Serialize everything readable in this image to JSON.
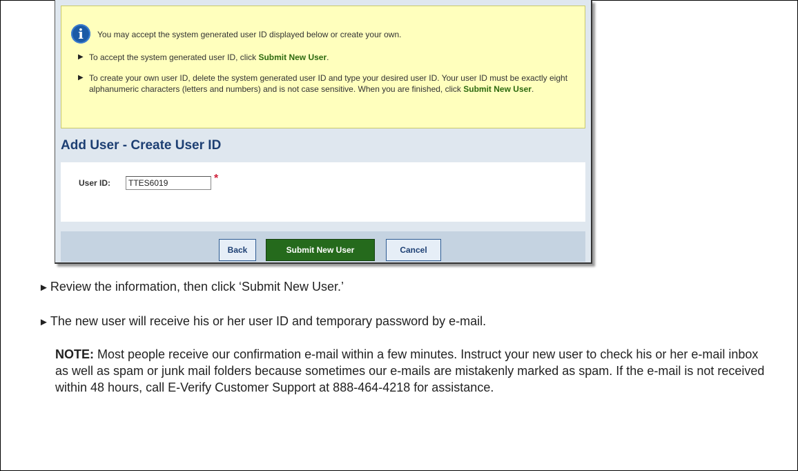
{
  "info": {
    "icon": "info-icon",
    "lead": "You may accept the system generated user ID displayed below or create your own.",
    "bullet1_pre": "To accept the system generated user ID, click ",
    "bullet1_bold": "Submit New User",
    "bullet1_post": ".",
    "bullet2_pre": "To create your own user ID, delete the system generated user ID and type your desired user ID. Your user ID must be exactly eight alphanumeric characters (letters and numbers) and is not case sensitive. When you are finished, click ",
    "bullet2_bold": "Submit New User",
    "bullet2_post": "."
  },
  "section_title": "Add User - Create User ID",
  "form": {
    "user_id_label": "User ID:",
    "user_id_value": "TTES6019",
    "required_mark": "*"
  },
  "buttons": {
    "back": "Back",
    "submit": "Submit New User",
    "cancel": "Cancel"
  },
  "instructions": {
    "arrow": "►",
    "step1": "Review the information, then click ‘Submit New User.’",
    "step2": "The new user will receive his or her user ID and temporary password by e-mail.",
    "note_label": "NOTE:",
    "note_text": " Most people receive our confirmation e-mail within a few minutes. Instruct your new user to check his or her e-mail inbox as well as spam or junk mail folders because sometimes our e-mails are mistakenly marked as spam. If the e-mail is not received within 48 hours, call E-Verify Customer Support at 888-464-4218 for assistance."
  },
  "colors": {
    "info_bg": "#ffffbd",
    "title_blue": "#1d3f73",
    "submit_green": "#256a1c",
    "required_red": "#d0203a"
  }
}
